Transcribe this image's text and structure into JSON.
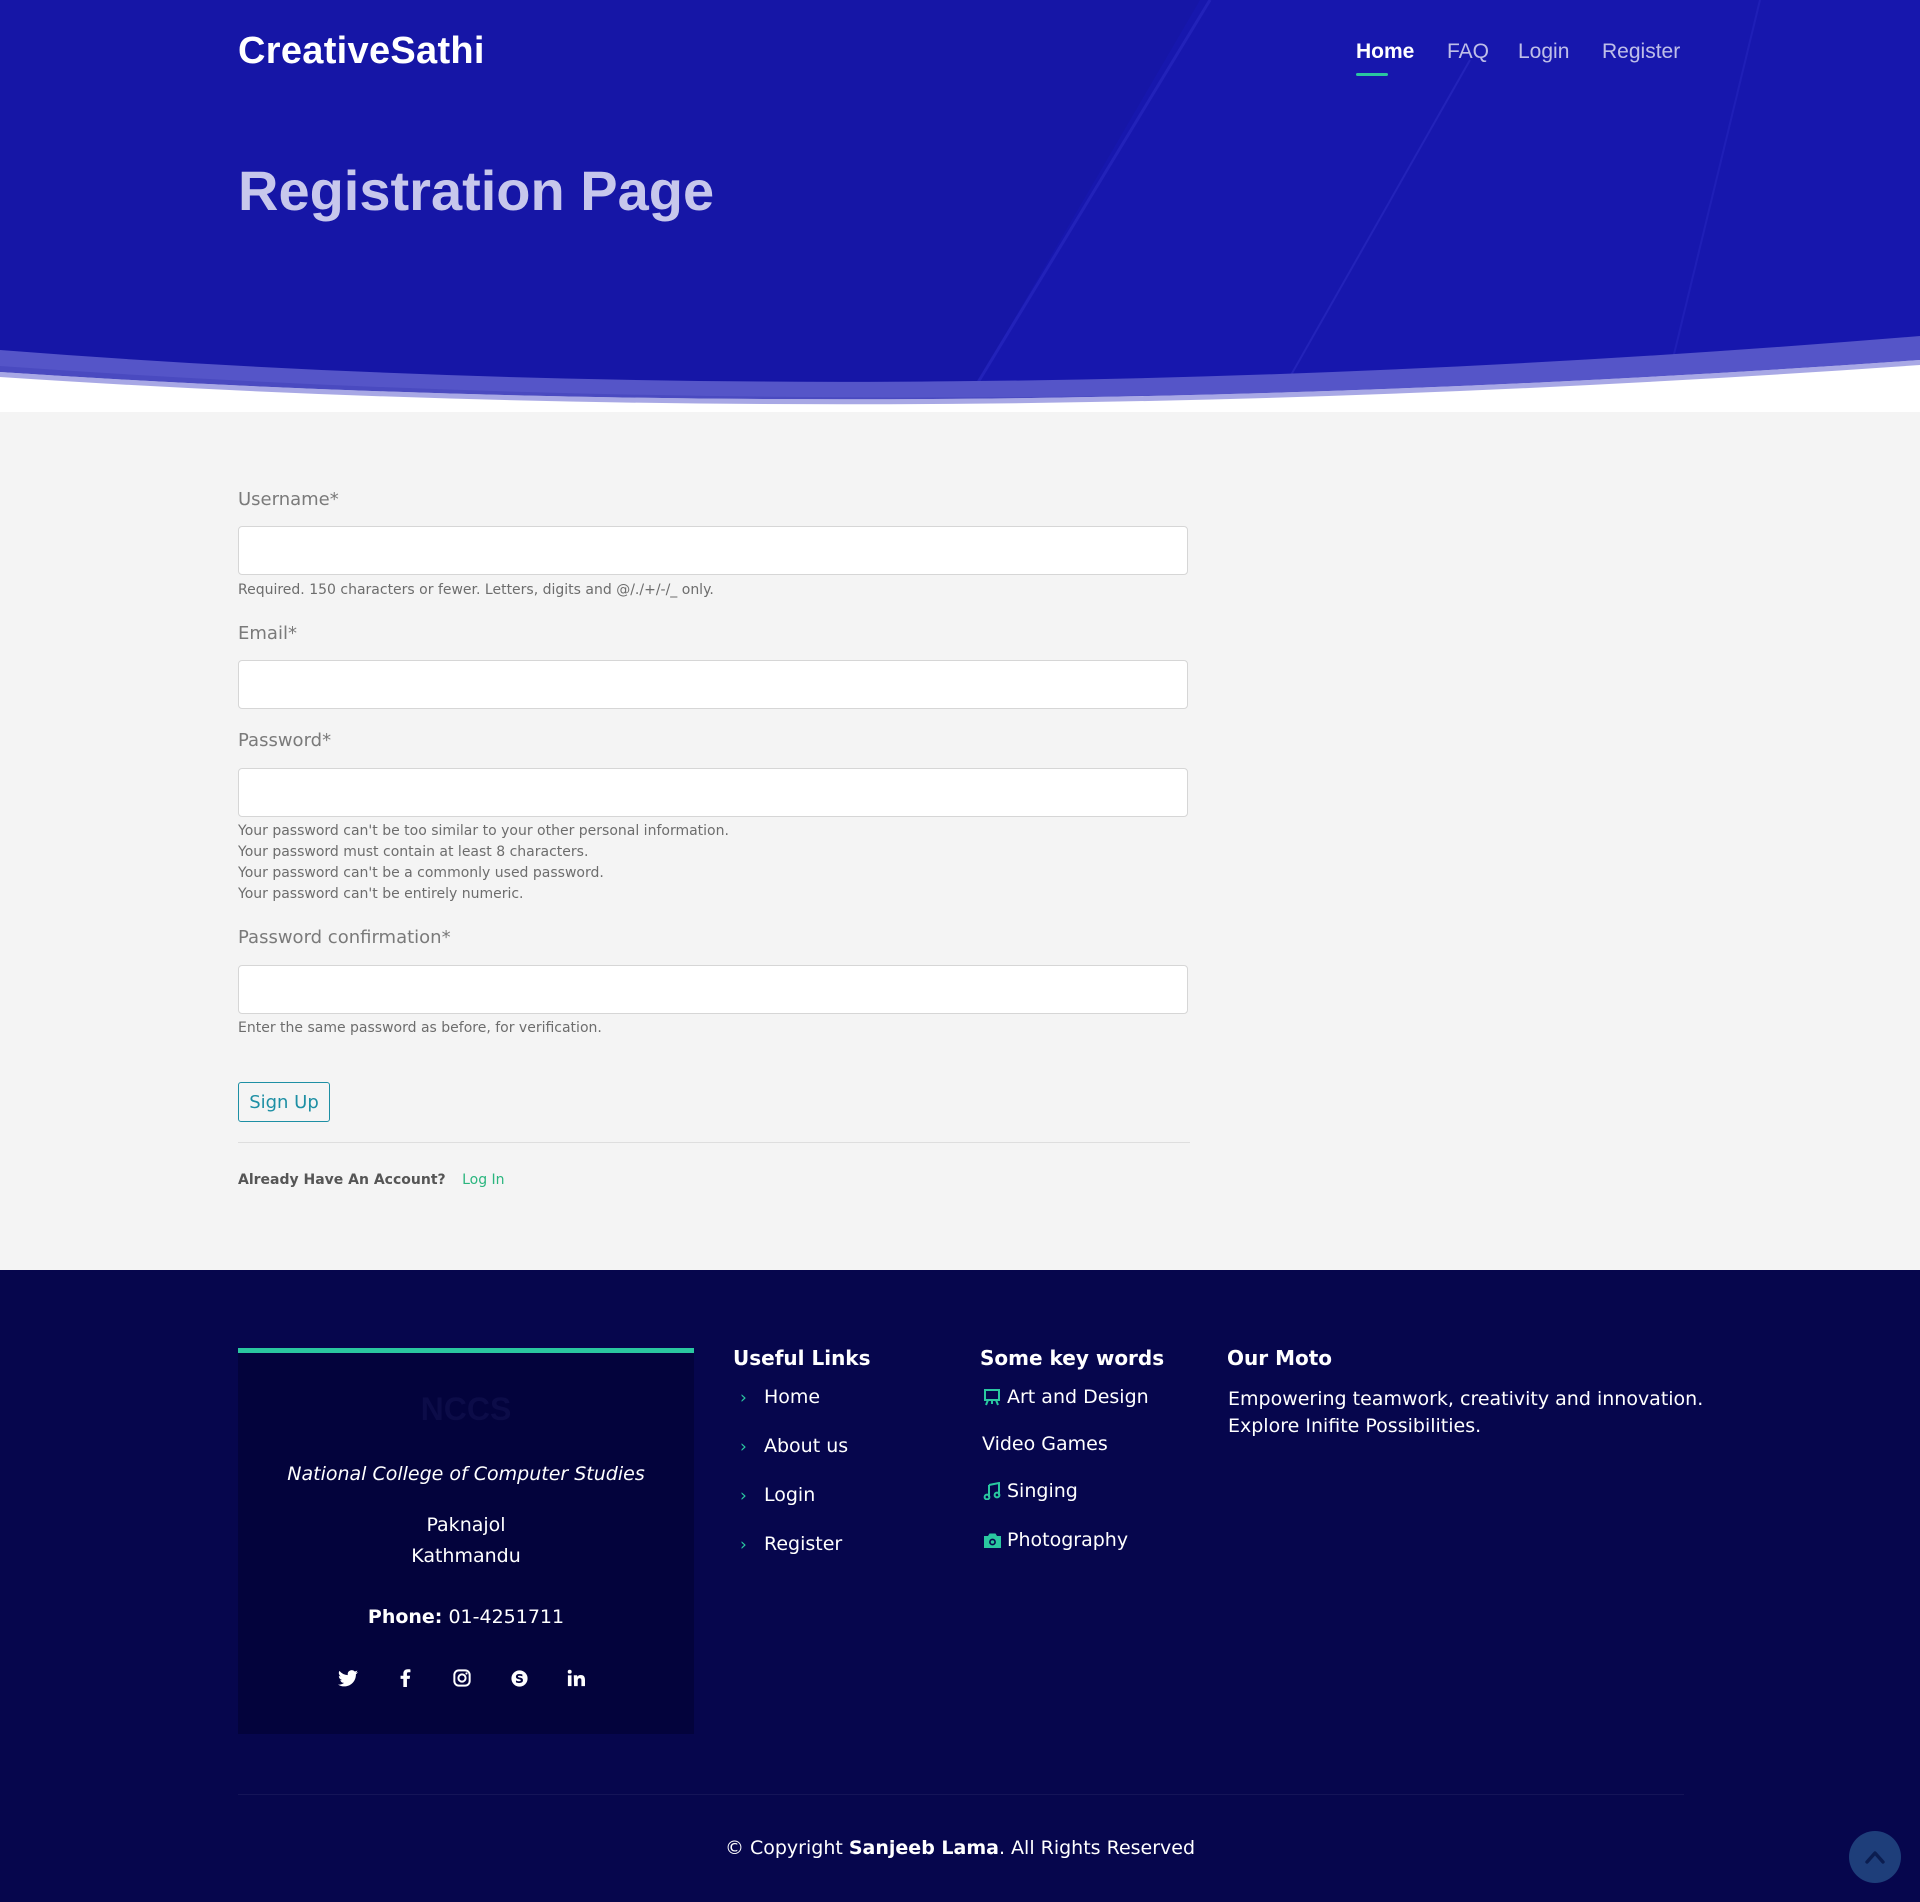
{
  "header": {
    "brand": "CreativeSathi",
    "nav": [
      {
        "label": "Home",
        "active": true
      },
      {
        "label": "FAQ",
        "active": false
      },
      {
        "label": "Login",
        "active": false
      },
      {
        "label": "Register",
        "active": false
      }
    ],
    "page_title": "Registration Page"
  },
  "form": {
    "username": {
      "label": "Username*",
      "value": "",
      "help": "Required. 150 characters or fewer. Letters, digits and @/./+/-/_ only."
    },
    "email": {
      "label": "Email*",
      "value": ""
    },
    "password": {
      "label": "Password*",
      "value": "",
      "help": [
        "Your password can't be too similar to your other personal information.",
        "Your password must contain at least 8 characters.",
        "Your password can't be a commonly used password.",
        "Your password can't be entirely numeric."
      ]
    },
    "password_confirm": {
      "label": "Password confirmation*",
      "value": "",
      "help": "Enter the same password as before, for verification."
    },
    "submit_label": "Sign Up",
    "account_question": "Already Have An Account?",
    "login_link": "Log In"
  },
  "footer": {
    "card": {
      "logo": "NCCS",
      "college": "National College of Computer Studies",
      "address_line1": "Paknajol",
      "address_line2": "Kathmandu",
      "phone_label": "Phone:",
      "phone": "01-4251711",
      "socials": [
        "twitter-icon",
        "facebook-icon",
        "instagram-icon",
        "skype-icon",
        "linkedin-icon"
      ]
    },
    "useful_links": {
      "title": "Useful Links",
      "items": [
        "Home",
        "About us",
        "Login",
        "Register"
      ]
    },
    "keywords": {
      "title": "Some key words",
      "items": [
        {
          "label": "Art and Design",
          "icon": "easel-icon"
        },
        {
          "label": "Video Games",
          "icon": ""
        },
        {
          "label": "Singing",
          "icon": "music-note-icon"
        },
        {
          "label": "Photography",
          "icon": "camera-icon"
        }
      ]
    },
    "moto": {
      "title": "Our Moto",
      "text": "Empowering teamwork, creativity and innovation. Explore Inifite Possibilities."
    },
    "copyright_prefix": "© Copyright",
    "copyright_owner": "Sanjeeb Lama",
    "copyright_suffix": ". All Rights Reserved"
  },
  "colors": {
    "hero_bg": "#1616a6",
    "footer_bg": "#06064d",
    "accent_green": "#2ac7a0",
    "button_teal": "#1d8fa4"
  }
}
